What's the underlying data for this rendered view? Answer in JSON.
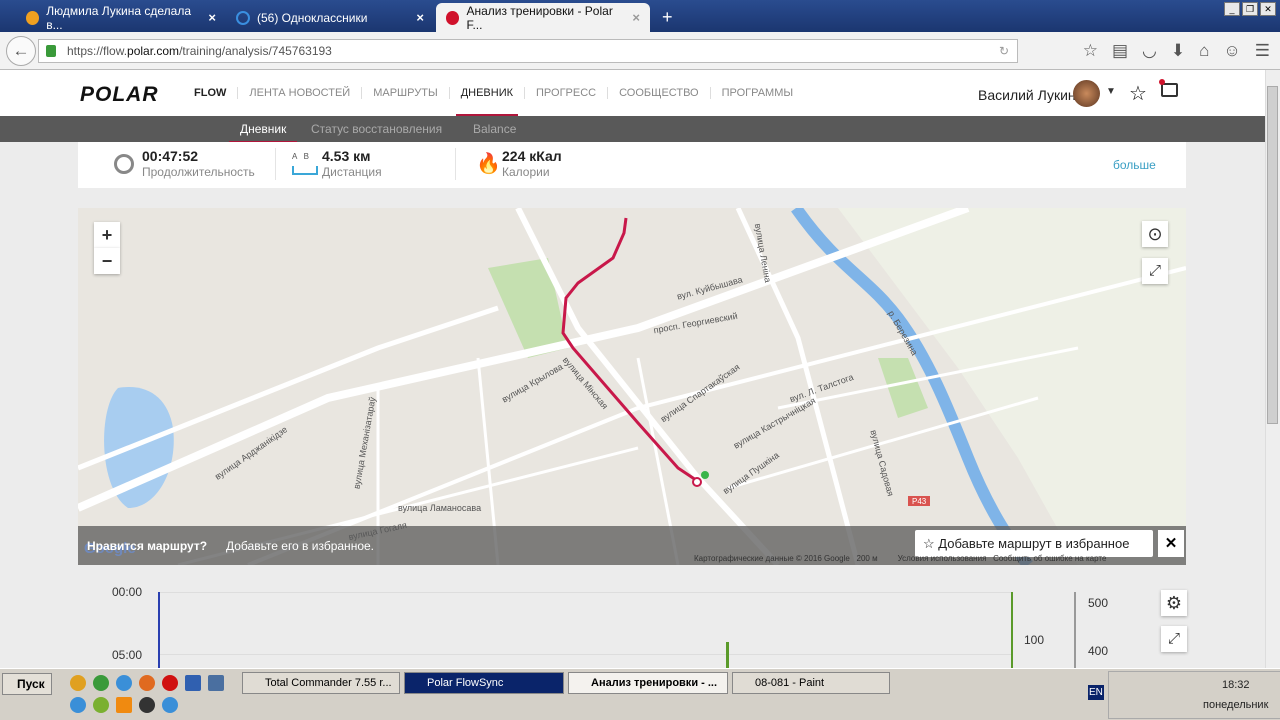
{
  "browser": {
    "tabs": [
      {
        "title": "Людмила Лукина сделала в...",
        "color": "#f0a020"
      },
      {
        "title": "(56) Одноклассники",
        "color": "#3a8fe0"
      },
      {
        "title": "Анализ тренировки - Polar F...",
        "color": "#d0112b"
      }
    ],
    "url_prefix": "https://flow.",
    "url_domain": "polar.com",
    "url_path": "/training/analysis/745763193"
  },
  "header": {
    "logo": "POLAR",
    "nav": [
      "FLOW",
      "ЛЕНТА НОВОСТЕЙ",
      "МАРШРУТЫ",
      "ДНЕВНИК",
      "ПРОГРЕСС",
      "СООБЩЕСТВО",
      "ПРОГРАММЫ"
    ],
    "active_nav": "ДНЕВНИК",
    "user": "Василий Лукин"
  },
  "subnav": [
    "Дневник",
    "Статус восстановления",
    "Balance"
  ],
  "summary": {
    "duration": "00:47:52",
    "duration_label": "Продолжительность",
    "distance": "4.53 км",
    "distance_label": "Дистанция",
    "ab": "A   B",
    "calories": "224 кКал",
    "calories_label": "Калории",
    "more": "больше"
  },
  "map": {
    "streets": [
      "вулица Мінская",
      "вулица Крылова",
      "просп. Георгиевский",
      "вулица Леніна",
      "вулица Гогаля",
      "вулица Кастрычніцкая",
      "вулица Пушкіна",
      "вулица Спартакаўская",
      "вул. Куйбышава",
      "р. Березина",
      "вулица Арджанікідзе",
      "вулица Механізатараў",
      "вулица Ламаносава",
      "вулица Садовая",
      "вул. Л. Талстога",
      "P43"
    ],
    "promo_question": "Нравится маршрут?",
    "promo_text": "Добавьте его в избранное.",
    "fav_button": "Добавьте маршрут в избранное",
    "attribution": "Картографические данные © 2016 Google",
    "scale": "200 м",
    "terms": "Условия использования",
    "report": "Сообщить об ошибке на карте",
    "google": "Google"
  },
  "chart": {
    "time_ticks": [
      "00:00",
      "05:00"
    ],
    "hr_tick": "100",
    "right_ticks": [
      "500",
      "400"
    ]
  },
  "taskbar": {
    "start": "Пуск",
    "tasks": [
      "Total Commander 7.55 r...",
      "Polar FlowSync",
      "Анализ тренировки - ...",
      "08-081 - Paint"
    ],
    "lang": "EN",
    "time": "18:32",
    "day": "понедельник"
  }
}
